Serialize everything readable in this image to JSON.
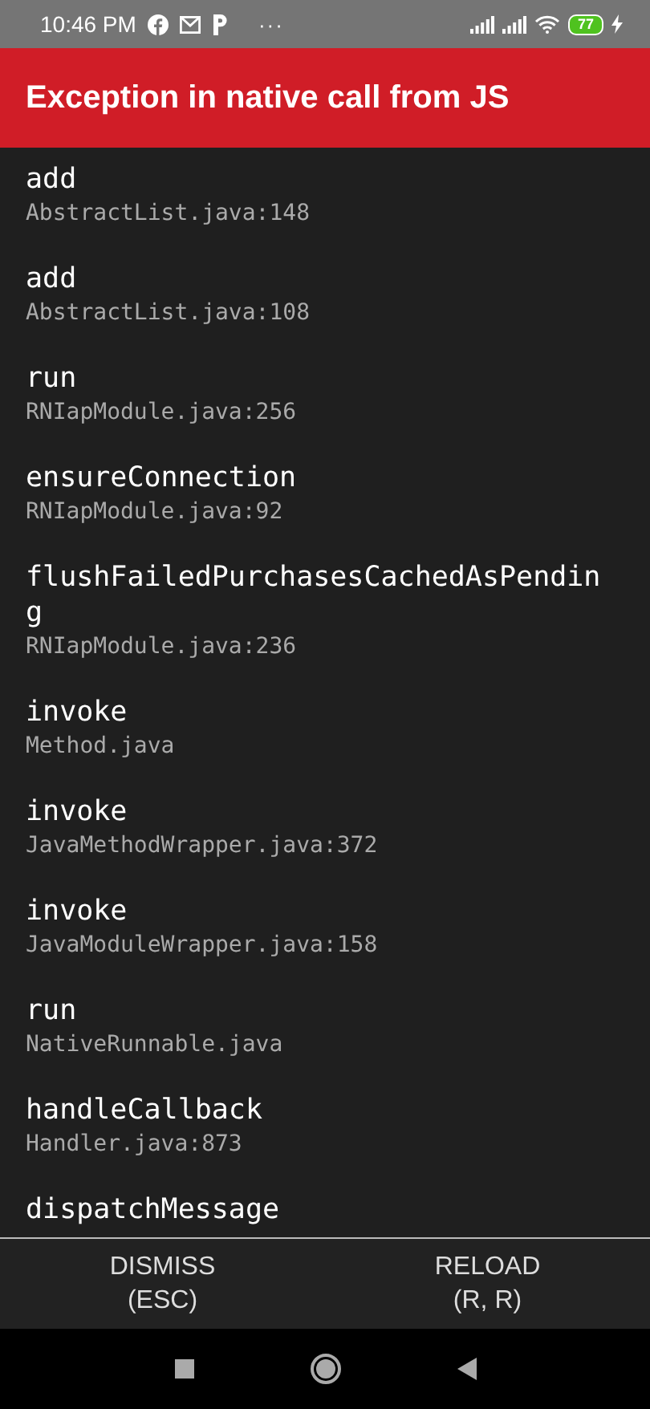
{
  "status_bar": {
    "time": "10:46 PM",
    "more": "···",
    "battery": "77"
  },
  "title": "Exception in native call from JS",
  "frames": [
    {
      "method": "add",
      "file": "AbstractList.java:148"
    },
    {
      "method": "add",
      "file": "AbstractList.java:108"
    },
    {
      "method": "run",
      "file": "RNIapModule.java:256"
    },
    {
      "method": "ensureConnection",
      "file": "RNIapModule.java:92"
    },
    {
      "method": "flushFailedPurchasesCachedAsPending",
      "file": "RNIapModule.java:236"
    },
    {
      "method": "invoke",
      "file": "Method.java"
    },
    {
      "method": "invoke",
      "file": "JavaMethodWrapper.java:372"
    },
    {
      "method": "invoke",
      "file": "JavaModuleWrapper.java:158"
    },
    {
      "method": "run",
      "file": "NativeRunnable.java"
    },
    {
      "method": "handleCallback",
      "file": "Handler.java:873"
    },
    {
      "method": "dispatchMessage"
    }
  ],
  "buttons": [
    {
      "label": "DISMISS\n(ESC)"
    },
    {
      "label": "RELOAD\n(R, R)"
    }
  ]
}
